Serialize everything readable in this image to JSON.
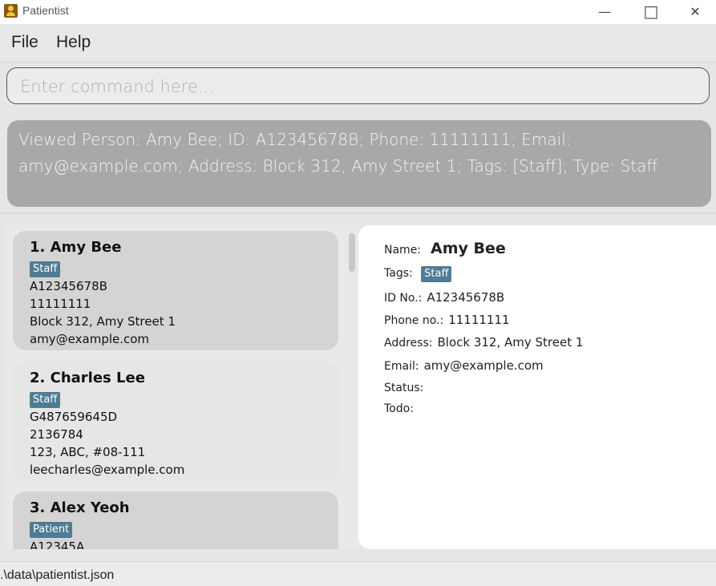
{
  "window": {
    "title": "Patientist",
    "minimize_glyph": "—",
    "maximize_glyph": "□",
    "close_glyph": "✕"
  },
  "menu": {
    "file": "File",
    "help": "Help"
  },
  "command": {
    "placeholder": "Enter command here...",
    "value": ""
  },
  "result": {
    "text": "Viewed Person: Amy Bee; ID: A12345678B; Phone: 11111111; Email: amy@example.com; Address: Block 312, Amy Street 1; Tags: [Staff]; Type: Staff"
  },
  "persons": [
    {
      "title": "1.  Amy Bee",
      "tag": "Staff",
      "id": "A12345678B",
      "phone": "11111111",
      "address": "Block 312, Amy Street 1",
      "email": "amy@example.com"
    },
    {
      "title": "2.  Charles Lee",
      "tag": "Staff",
      "id": "G487659645D",
      "phone": "2136784",
      "address": "123, ABC, #08-111",
      "email": "leecharles@example.com"
    },
    {
      "title": "3.  Alex Yeoh",
      "tag": "Patient",
      "id": "A12345A"
    }
  ],
  "detail": {
    "name_label": "Name:",
    "name": "Amy Bee",
    "tags_label": "Tags:",
    "tag": "Staff",
    "id_label": "ID No.:",
    "id": "A12345678B",
    "phone_label": "Phone no.:",
    "phone": "11111111",
    "address_label": "Address:",
    "address": "Block 312, Amy Street 1",
    "email_label": "Email:",
    "email": "amy@example.com",
    "status_label": "Status:",
    "todo_label": "Todo:"
  },
  "status_bar": {
    "path": ".\\data\\patientist.json"
  },
  "colors": {
    "tag": "#4e7c93",
    "result_bg": "#a8a8a8"
  }
}
